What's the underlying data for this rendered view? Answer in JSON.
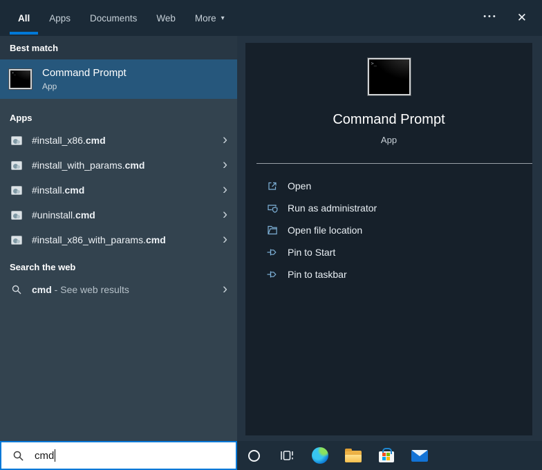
{
  "topbar": {
    "tabs": [
      {
        "label": "All"
      },
      {
        "label": "Apps"
      },
      {
        "label": "Documents"
      },
      {
        "label": "Web"
      },
      {
        "label": "More"
      }
    ],
    "active_tab": "All",
    "more_caret": "▾",
    "ellipsis_glyph": "•••",
    "close_glyph": "✕"
  },
  "left": {
    "best_match": {
      "header": "Best match",
      "item": {
        "title": "Command Prompt",
        "subtitle": "App"
      }
    },
    "apps": {
      "header": "Apps",
      "items": [
        {
          "prefix": "#install_x86.",
          "bold": "cmd"
        },
        {
          "prefix": "#install_with_params.",
          "bold": "cmd"
        },
        {
          "prefix": "#install.",
          "bold": "cmd"
        },
        {
          "prefix": "#uninstall.",
          "bold": "cmd"
        },
        {
          "prefix": "#install_x86_with_params.",
          "bold": "cmd"
        }
      ]
    },
    "web": {
      "header": "Search the web",
      "item": {
        "query": "cmd",
        "rest": " - See web results"
      }
    },
    "chevron_glyph": "›"
  },
  "preview": {
    "title": "Command Prompt",
    "subtitle": "App",
    "actions": [
      {
        "label": "Open",
        "icon": "open-icon"
      },
      {
        "label": "Run as administrator",
        "icon": "shield-icon"
      },
      {
        "label": "Open file location",
        "icon": "folder-icon"
      },
      {
        "label": "Pin to Start",
        "icon": "pin-icon"
      },
      {
        "label": "Pin to taskbar",
        "icon": "pin-icon"
      }
    ]
  },
  "search": {
    "value": "cmd"
  },
  "taskbar": {
    "icons": [
      "cortana",
      "task-view",
      "edge",
      "file-explorer",
      "store",
      "mail"
    ]
  },
  "colors": {
    "accent": "#0078d7",
    "best_match_highlight": "#26577c",
    "topbar_bg": "#1b2a37",
    "left_panel_bg": "#33434f",
    "preview_card_bg": "#16202a",
    "action_icon_blue": "#7fb2d9"
  }
}
